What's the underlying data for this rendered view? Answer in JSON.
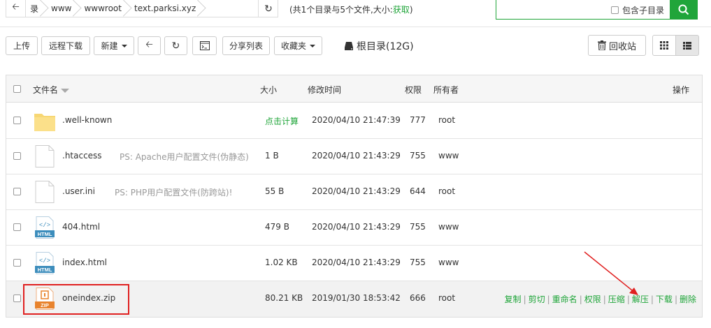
{
  "pathbar": {
    "crumbs": [
      "录",
      "www",
      "wwwroot",
      "text.parksi.xyz"
    ]
  },
  "summary": {
    "text": "(共1个目录与5个文件,大小:",
    "link": "获取",
    "suffix": ")"
  },
  "search": {
    "placeholder": "",
    "include_sub_label": "包含子目录"
  },
  "toolbar": {
    "upload": "上传",
    "remote_download": "远程下载",
    "new": "新建",
    "share_list": "分享列表",
    "favorites": "收藏夹",
    "root_dir": "根目录(12G)",
    "recycle_bin": "回收站"
  },
  "table": {
    "headers": {
      "name": "文件名",
      "size": "大小",
      "mtime": "修改时间",
      "perm": "权限",
      "owner": "所有者",
      "ops": "操作"
    },
    "rows": [
      {
        "name": ".well-known",
        "note": "",
        "size": "点击计算",
        "mtime": "2020/04/10 21:47:39",
        "perm": "777",
        "owner": "root",
        "type": "folder"
      },
      {
        "name": ".htaccess",
        "note": "PS: Apache用户配置文件(伪静态)",
        "size": "1 B",
        "mtime": "2020/04/10 21:43:29",
        "perm": "755",
        "owner": "www",
        "type": "file"
      },
      {
        "name": ".user.ini",
        "note": "PS: PHP用户配置文件(防跨站)!",
        "size": "55 B",
        "mtime": "2020/04/10 21:43:29",
        "perm": "644",
        "owner": "root",
        "type": "file"
      },
      {
        "name": "404.html",
        "note": "",
        "size": "479 B",
        "mtime": "2020/04/10 21:43:29",
        "perm": "755",
        "owner": "www",
        "type": "html"
      },
      {
        "name": "index.html",
        "note": "",
        "size": "1.02 KB",
        "mtime": "2020/04/10 21:43:29",
        "perm": "755",
        "owner": "www",
        "type": "html"
      },
      {
        "name": "oneindex.zip",
        "note": "",
        "size": "80.21 KB",
        "mtime": "2019/01/30 18:53:42",
        "perm": "666",
        "owner": "root",
        "type": "zip"
      }
    ],
    "row_actions": [
      "复制",
      "剪切",
      "重命名",
      "权限",
      "压缩",
      "解压",
      "下载",
      "删除"
    ]
  },
  "icons": {
    "html_label": "HTML",
    "zip_label": "ZIP",
    "html_glyph": "</>"
  },
  "colors": {
    "accent": "#20a53a",
    "highlight": "#e02020",
    "folder": "#f7d774"
  }
}
